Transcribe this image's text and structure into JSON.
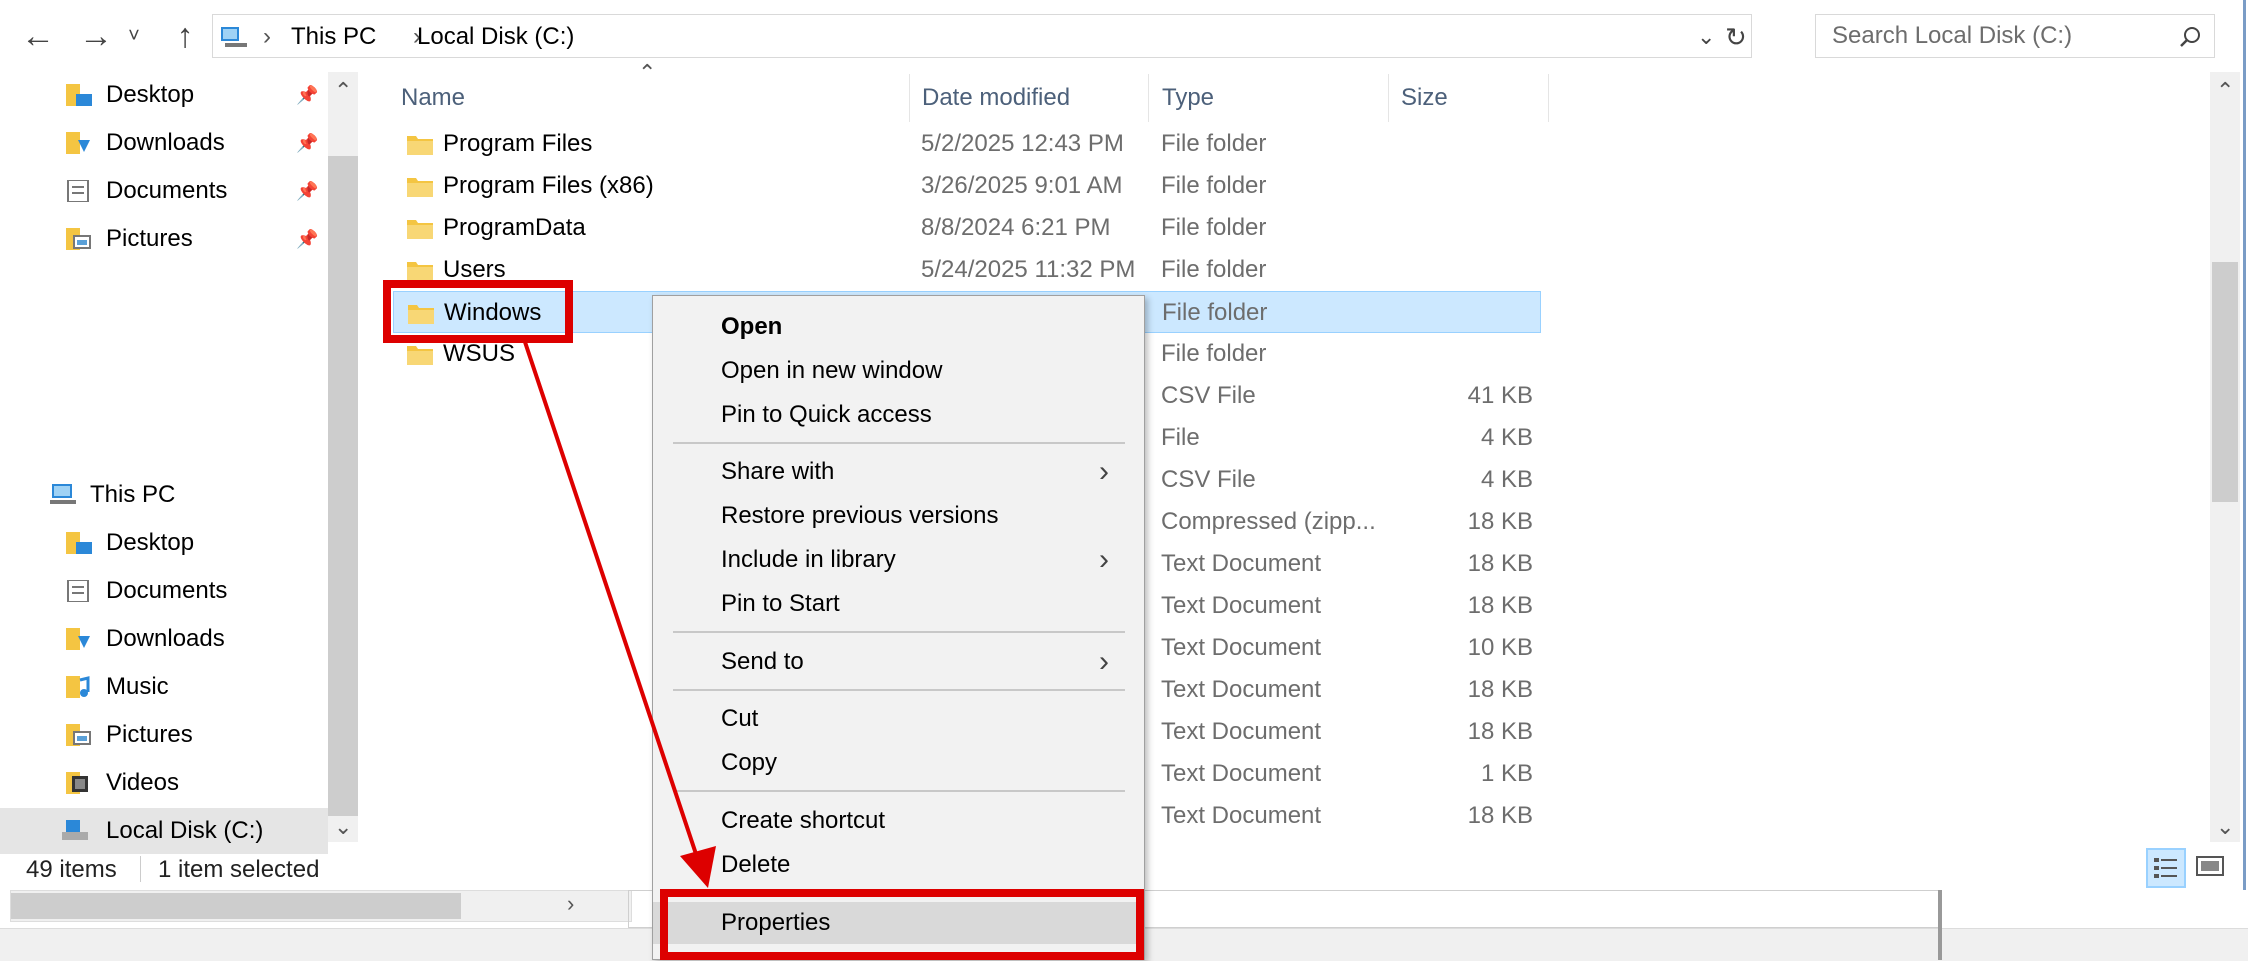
{
  "address": {
    "crumbs": [
      "This PC",
      "Local Disk (C:)"
    ],
    "search_placeholder": "Search Local Disk (C:)"
  },
  "nav": {
    "quick_access": [
      {
        "label": "Desktop",
        "pinned": true
      },
      {
        "label": "Downloads",
        "pinned": true
      },
      {
        "label": "Documents",
        "pinned": true
      },
      {
        "label": "Pictures",
        "pinned": true
      }
    ],
    "this_pc": "This PC",
    "this_pc_items": [
      "Desktop",
      "Documents",
      "Downloads",
      "Music",
      "Pictures",
      "Videos",
      "Local Disk (C:)"
    ]
  },
  "columns": {
    "name": "Name",
    "date": "Date modified",
    "type": "Type",
    "size": "Size"
  },
  "rows": [
    {
      "name": "Program Files",
      "date": "5/2/2025 12:43 PM",
      "type": "File folder",
      "size": ""
    },
    {
      "name": "Program Files (x86)",
      "date": "3/26/2025 9:01 AM",
      "type": "File folder",
      "size": ""
    },
    {
      "name": "ProgramData",
      "date": "8/8/2024 6:21 PM",
      "type": "File folder",
      "size": ""
    },
    {
      "name": "Users",
      "date": "5/24/2025 11:32 PM",
      "type": "File folder",
      "size": ""
    },
    {
      "name": "Windows",
      "date": "",
      "type": "File folder",
      "size": ""
    },
    {
      "name": "WSUS",
      "date": "",
      "type": "File folder",
      "size": ""
    },
    {
      "name": "",
      "date": "",
      "type": "CSV File",
      "size": "41 KB"
    },
    {
      "name": "",
      "date": "",
      "type": "File",
      "size": "4 KB"
    },
    {
      "name": "",
      "date": "",
      "type": "CSV File",
      "size": "4 KB"
    },
    {
      "name": "",
      "date": "",
      "type": "Compressed (zipp...",
      "size": "18 KB"
    },
    {
      "name": "",
      "date": "",
      "type": "Text Document",
      "size": "18 KB"
    },
    {
      "name": "",
      "date": "",
      "type": "Text Document",
      "size": "18 KB"
    },
    {
      "name": "",
      "date": "",
      "type": "Text Document",
      "size": "10 KB"
    },
    {
      "name": "",
      "date": "",
      "type": "Text Document",
      "size": "18 KB"
    },
    {
      "name": "",
      "date": "",
      "type": "Text Document",
      "size": "18 KB"
    },
    {
      "name": "",
      "date": "",
      "type": "Text Document",
      "size": "1 KB"
    },
    {
      "name": "",
      "date": "",
      "type": "Text Document",
      "size": "18 KB"
    }
  ],
  "status": {
    "items": "49 items",
    "selected": "1 item selected"
  },
  "context_menu": {
    "open": "Open",
    "open_new_window": "Open in new window",
    "pin_quick_access": "Pin to Quick access",
    "share_with": "Share with",
    "restore_versions": "Restore previous versions",
    "include_library": "Include in library",
    "pin_start": "Pin to Start",
    "send_to": "Send to",
    "cut": "Cut",
    "copy": "Copy",
    "create_shortcut": "Create shortcut",
    "delete": "Delete",
    "properties": "Properties"
  },
  "colors": {
    "selection": "#cce8ff",
    "annotation": "#dd0000",
    "header_text": "#4c607a"
  }
}
